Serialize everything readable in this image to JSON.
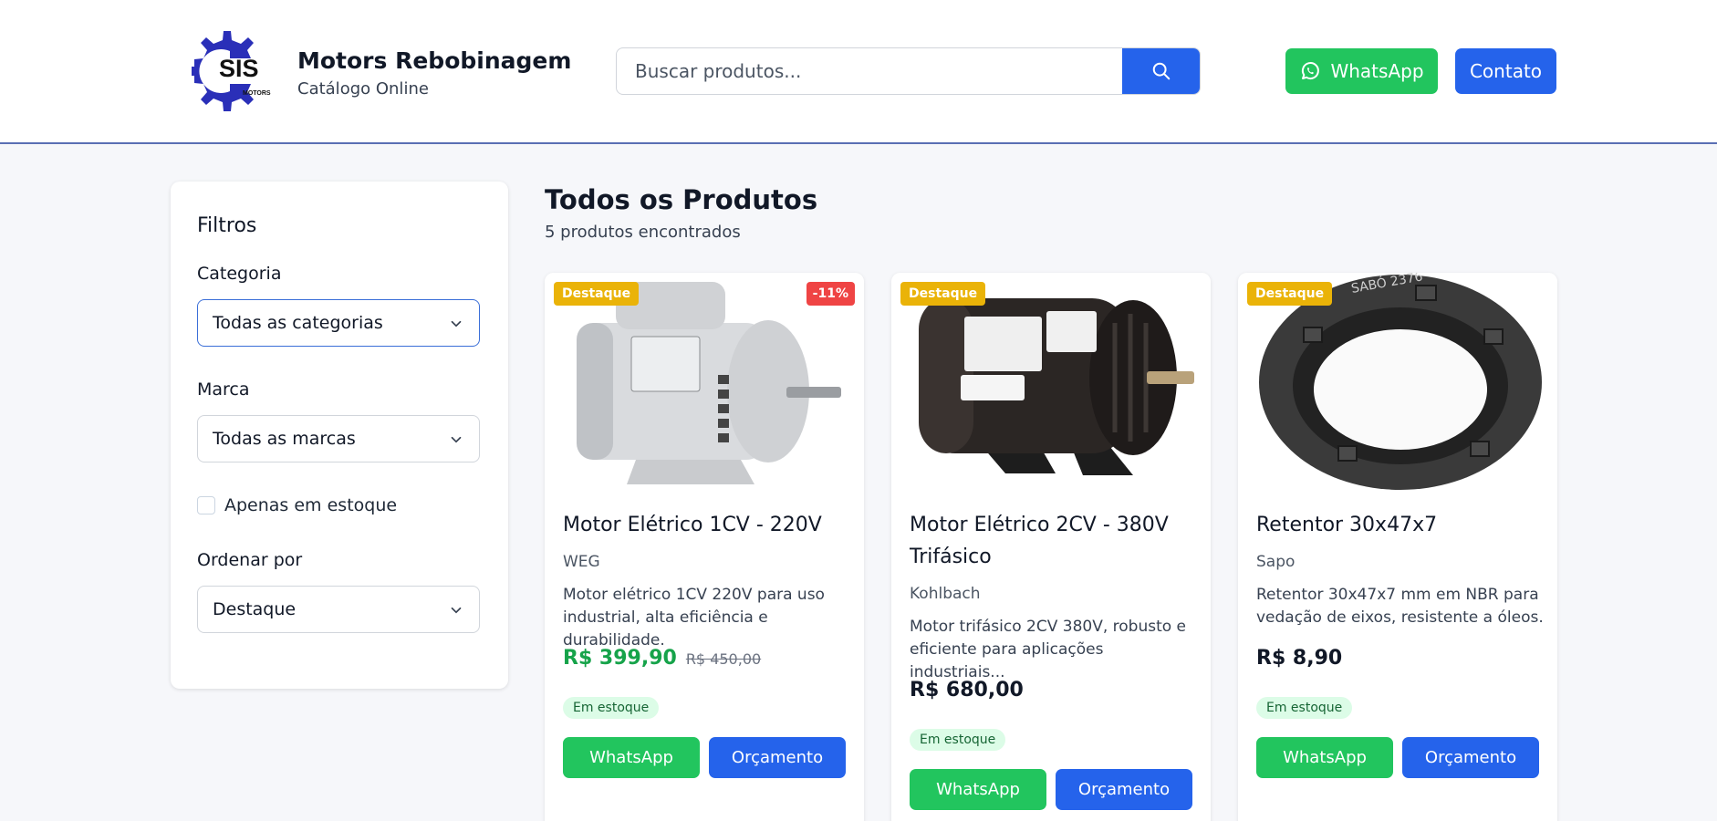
{
  "header": {
    "logo_text": "SIS",
    "logo_sub": "MOTORS",
    "brand_title": "Motors Rebobinagem",
    "brand_subtitle": "Catálogo Online",
    "search_placeholder": "Buscar produtos...",
    "whatsapp_label": "WhatsApp",
    "contact_label": "Contato"
  },
  "filters": {
    "title": "Filtros",
    "category_label": "Categoria",
    "category_value": "Todas as categorias",
    "brand_label": "Marca",
    "brand_value": "Todas as marcas",
    "in_stock_label": "Apenas em estoque",
    "sort_label": "Ordenar por",
    "sort_value": "Destaque"
  },
  "main": {
    "title": "Todos os Produtos",
    "count": "5 produtos encontrados"
  },
  "products": [
    {
      "badge": "Destaque",
      "discount": "-11%",
      "name": "Motor Elétrico 1CV - 220V",
      "brand": "WEG",
      "description": "Motor elétrico 1CV 220V para uso industrial, alta eficiência e durabilidade.",
      "price": "R$ 399,90",
      "old_price": "R$ 450,00",
      "stock": "Em estoque",
      "whatsapp": "WhatsApp",
      "quote": "Orçamento"
    },
    {
      "badge": "Destaque",
      "name": "Motor Elétrico 2CV - 380V Trifásico",
      "brand": "Kohlbach",
      "description": "Motor trifásico 2CV 380V, robusto e eficiente para aplicações industriais...",
      "price": "R$ 680,00",
      "stock": "Em estoque",
      "whatsapp": "WhatsApp",
      "quote": "Orçamento"
    },
    {
      "badge": "Destaque",
      "name": "Retentor 30x47x7",
      "brand": "Sapo",
      "description": "Retentor 30x47x7 mm em NBR para vedação de eixos, resistente a óleos.",
      "price": "R$ 8,90",
      "stock": "Em estoque",
      "whatsapp": "WhatsApp",
      "quote": "Orçamento",
      "image_text": "SABÓ 2376"
    }
  ],
  "colors": {
    "primary": "#2563eb",
    "whatsapp": "#22c55e",
    "featured": "#eab308",
    "discount": "#ef4444",
    "sale_price": "#16a34a"
  }
}
